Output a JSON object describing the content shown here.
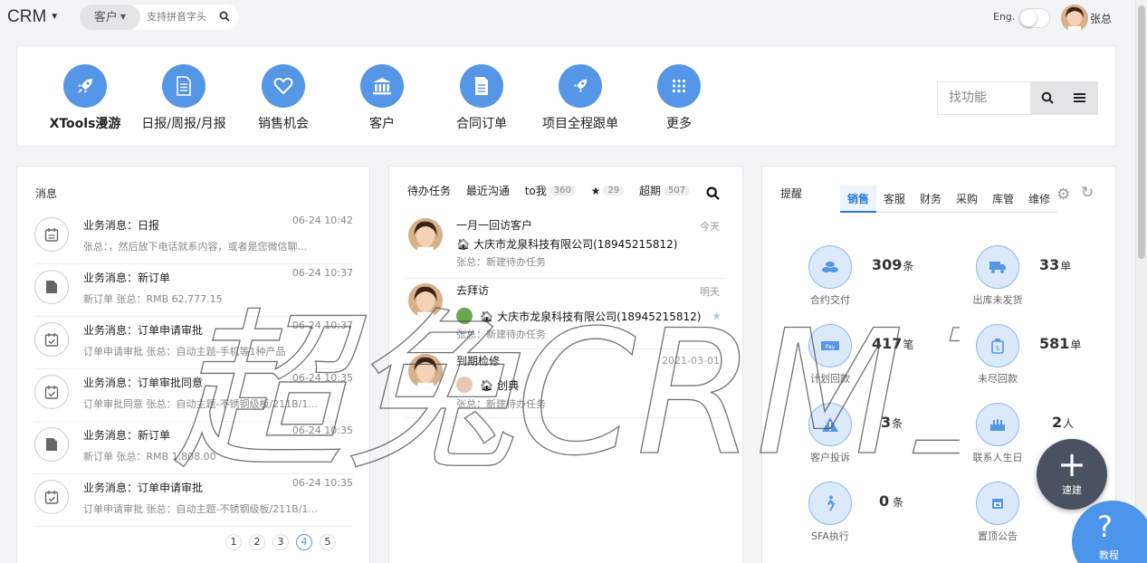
{
  "topbar": {
    "brand": "CRM",
    "search_scope": "客户",
    "search_placeholder": "支持拼音字头",
    "lang_label": "Eng.",
    "user_name": "张总"
  },
  "quick_nav": {
    "items": [
      {
        "label": "XTools漫游",
        "icon": "rocket-icon"
      },
      {
        "label": "日报/周报/月报",
        "icon": "document-icon"
      },
      {
        "label": "销售机会",
        "icon": "heart-icon"
      },
      {
        "label": "客户",
        "icon": "bank-icon"
      },
      {
        "label": "合同订单",
        "icon": "file-icon"
      },
      {
        "label": "项目全程跟单",
        "icon": "rocket-icon"
      },
      {
        "label": "更多",
        "icon": "grid-icon"
      }
    ],
    "func_search_placeholder": "找功能"
  },
  "messages": {
    "title": "消息",
    "items": [
      {
        "title": "业务消息：日报",
        "time": "06-24 10:42",
        "desc": "张总：，然后放下电话就系内容，或者是您微信聊...",
        "icon": "calendar-icon"
      },
      {
        "title": "业务消息：新订单",
        "time": "06-24 10:37",
        "desc": "新订单 张总：RMB 62,777.15",
        "icon": "file-icon"
      },
      {
        "title": "业务消息：订单申请审批",
        "time": "06-24 10:37",
        "desc": "订单申请审批 张总：自动主题-手机等1种产品",
        "icon": "calendar-check-icon"
      },
      {
        "title": "业务消息：订单审批同意",
        "time": "06-24 10:35",
        "desc": "订单审批同意 张总：自动主题-不锈钢级板/211B/1...",
        "icon": "calendar-check-icon"
      },
      {
        "title": "业务消息：新订单",
        "time": "06-24 10:35",
        "desc": "新订单 张总：RMB 1,808.00",
        "icon": "file-icon"
      },
      {
        "title": "业务消息：订单申请审批",
        "time": "06-24 10:35",
        "desc": "订单申请审批 张总：自动主题-不锈钢级板/211B/1...",
        "icon": "calendar-check-icon"
      }
    ],
    "pages": [
      "1",
      "2",
      "3",
      "4",
      "5"
    ],
    "active_page": "4"
  },
  "tasks": {
    "tabs": [
      {
        "label": "待办任务"
      },
      {
        "label": "最近沟通"
      },
      {
        "label": "to我",
        "badge": "360"
      },
      {
        "label": "",
        "icon": "star-icon",
        "badge": "29"
      },
      {
        "label": "超期",
        "badge": "507"
      }
    ],
    "items": [
      {
        "title": "一月一回访客户",
        "when": "今天",
        "company": "大庆市龙泉科技有限公司(18945215812)",
        "note": "张总：新建待办任务"
      },
      {
        "title": "去拜访",
        "when": "明天",
        "company": "大庆市龙泉科技有限公司(18945215812)",
        "note": "张总：新建待办任务"
      },
      {
        "title": "到期检修",
        "when": "2021-03-01",
        "company": "创典",
        "note": "张总：新建待办任务"
      }
    ]
  },
  "reminders": {
    "title": "提醒",
    "tabs": [
      "销售",
      "客服",
      "财务",
      "采购",
      "库管",
      "维修"
    ],
    "active_tab": "销售",
    "stats": [
      {
        "label": "合约交付",
        "value": "309",
        "unit": "条",
        "icon": "coins-icon"
      },
      {
        "label": "出库未发货",
        "value": "33",
        "unit": "单",
        "icon": "truck-icon"
      },
      {
        "label": "计划回款",
        "value": "417",
        "unit": "笔",
        "icon": "payment-icon"
      },
      {
        "label": "未尽回款",
        "value": "581",
        "unit": "单",
        "icon": "money-bag-icon"
      },
      {
        "label": "客户投诉",
        "value": "3",
        "unit": "条",
        "icon": "warning-icon"
      },
      {
        "label": "联系人生日",
        "value": "2",
        "unit": "人",
        "icon": "cake-icon"
      },
      {
        "label": "SFA执行",
        "value": "0",
        "unit": "条",
        "icon": "walker-icon"
      },
      {
        "label": "置顶公告",
        "value": "",
        "unit": "",
        "icon": "calendar-icon"
      }
    ]
  },
  "fab": {
    "label": "速建"
  },
  "help": {
    "label": "教程"
  },
  "watermark": {
    "text": "超兔CRM工作台"
  },
  "colors": {
    "accent": "#5596e6",
    "active_tab": "#2b7bd8",
    "fab": "#4a5160",
    "help": "#4b95ea"
  }
}
